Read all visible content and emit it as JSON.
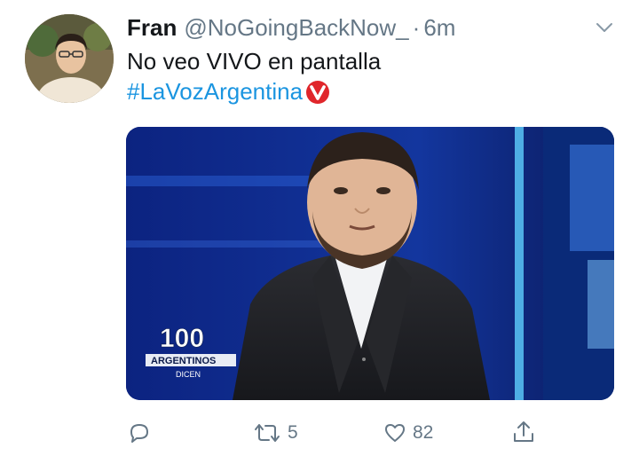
{
  "tweet": {
    "display_name": "Fran",
    "handle": "@NoGoingBackNow_",
    "separator": "·",
    "time": "6m",
    "text_line1": "No veo VIVO en pantalla",
    "hashtag": "#LaVozArgentina"
  },
  "media": {
    "logo_number": "100",
    "logo_banner": "ARGENTINOS",
    "logo_sub": "DICEN"
  },
  "actions": {
    "reply_count": "",
    "retweet_count": "5",
    "like_count": "82"
  },
  "icons": {
    "caret": "chevron-down-icon",
    "reply": "reply-icon",
    "retweet": "retweet-icon",
    "like": "heart-icon",
    "share": "share-icon",
    "hashflag": "la-voz-hashflag-icon"
  },
  "colors": {
    "link": "#1b95e0",
    "muted": "#657786",
    "hashflag": "#e0262b"
  }
}
